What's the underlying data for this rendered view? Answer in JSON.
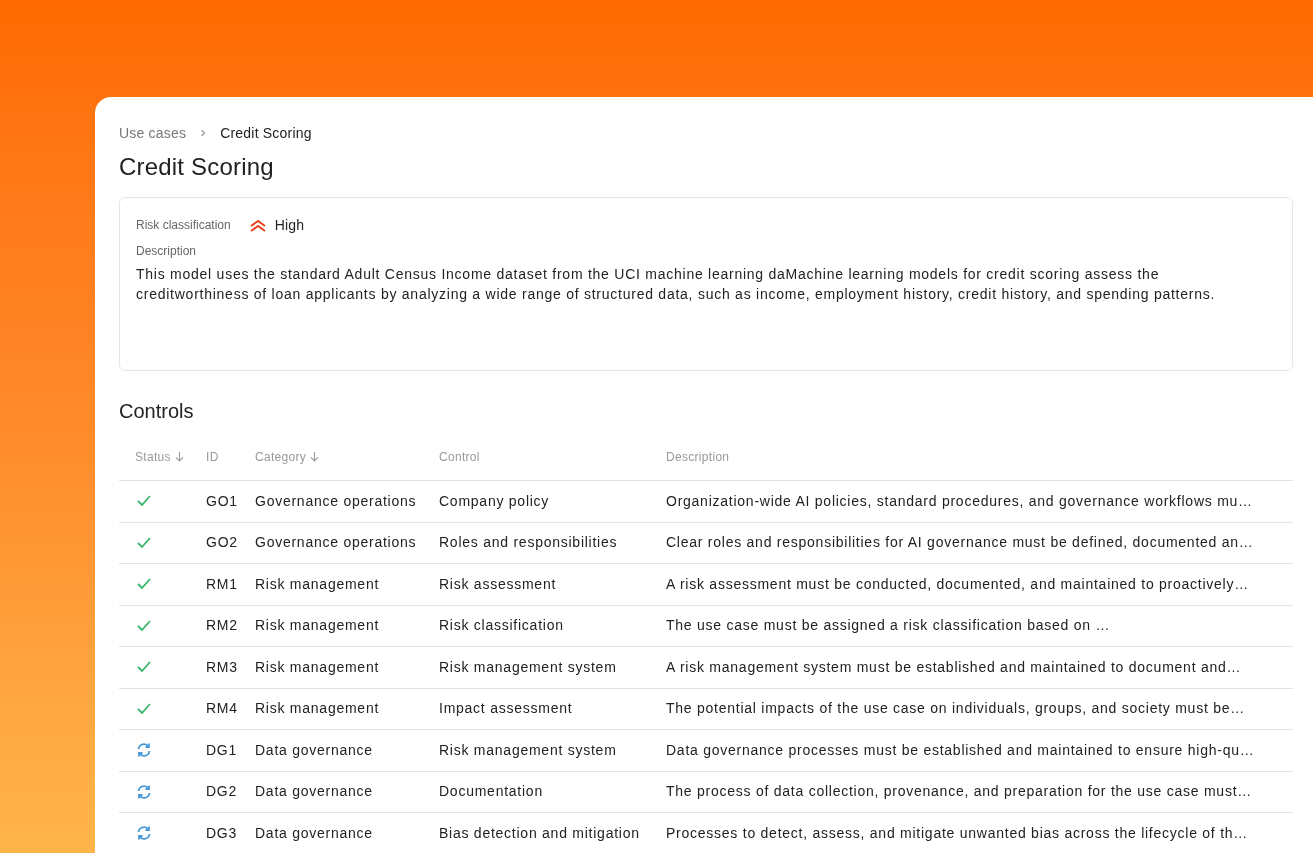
{
  "breadcrumb": [
    {
      "label": "Use cases",
      "current": false
    },
    {
      "label": "Credit Scoring",
      "current": true
    }
  ],
  "title": "Credit Scoring",
  "details": {
    "risk_label": "Risk classification",
    "risk": {
      "kind": "high",
      "label": "High"
    },
    "description_label": "Description",
    "description": "This model uses the standard Adult Census Income dataset from the UCI machine learning daMachine learning models for credit scoring assess the creditworthiness of loan applicants by analyzing a wide range of structured data, such as income, employment history, credit history, and spending patterns."
  },
  "controls": {
    "title": "Controls",
    "columns": [
      {
        "label": "Status",
        "sorted": true
      },
      {
        "label": "ID",
        "sorted": false
      },
      {
        "label": "Category",
        "sorted": true
      },
      {
        "label": "Control",
        "sorted": false
      },
      {
        "label": "Description",
        "sorted": false
      }
    ],
    "rows": [
      {
        "kind": "done",
        "id": "GO1",
        "category": "Governance operations",
        "control": "Company policy",
        "description": "Organization-wide AI policies, standard procedures, and governance workflows mu…"
      },
      {
        "kind": "done",
        "id": "GO2",
        "category": "Governance operations",
        "control": "Roles and responsibilities",
        "description": "Clear roles and responsibilities for AI governance must be defined, documented an…"
      },
      {
        "kind": "done",
        "id": "RM1",
        "category": "Risk management",
        "control": "Risk assessment",
        "description": "A risk assessment must be conducted, documented, and maintained to proactively…"
      },
      {
        "kind": "done",
        "id": "RM2",
        "category": "Risk management",
        "control": "Risk classification",
        "description": "The use case must be assigned a risk classification based on …"
      },
      {
        "kind": "done",
        "id": "RM3",
        "category": "Risk management",
        "control": "Risk management system",
        "description": "A risk management system must be established and maintained to document and…"
      },
      {
        "kind": "done",
        "id": "RM4",
        "category": "Risk management",
        "control": "Impact assessment",
        "description": "The potential impacts of the use case on individuals, groups, and society must be…"
      },
      {
        "kind": "in_progress",
        "id": "DG1",
        "category": "Data governance",
        "control": "Risk management system",
        "description": "Data governance processes must be established and maintained to ensure high-qu…"
      },
      {
        "kind": "in_progress",
        "id": "DG2",
        "category": "Data governance",
        "control": "Documentation",
        "description": "The process of data collection, provenance, and preparation for the use case must…"
      },
      {
        "kind": "in_progress",
        "id": "DG3",
        "category": "Data governance",
        "control": "Bias detection and mitigation",
        "description": "Processes to detect, assess, and mitigate unwanted bias across the lifecycle of th…"
      }
    ]
  }
}
